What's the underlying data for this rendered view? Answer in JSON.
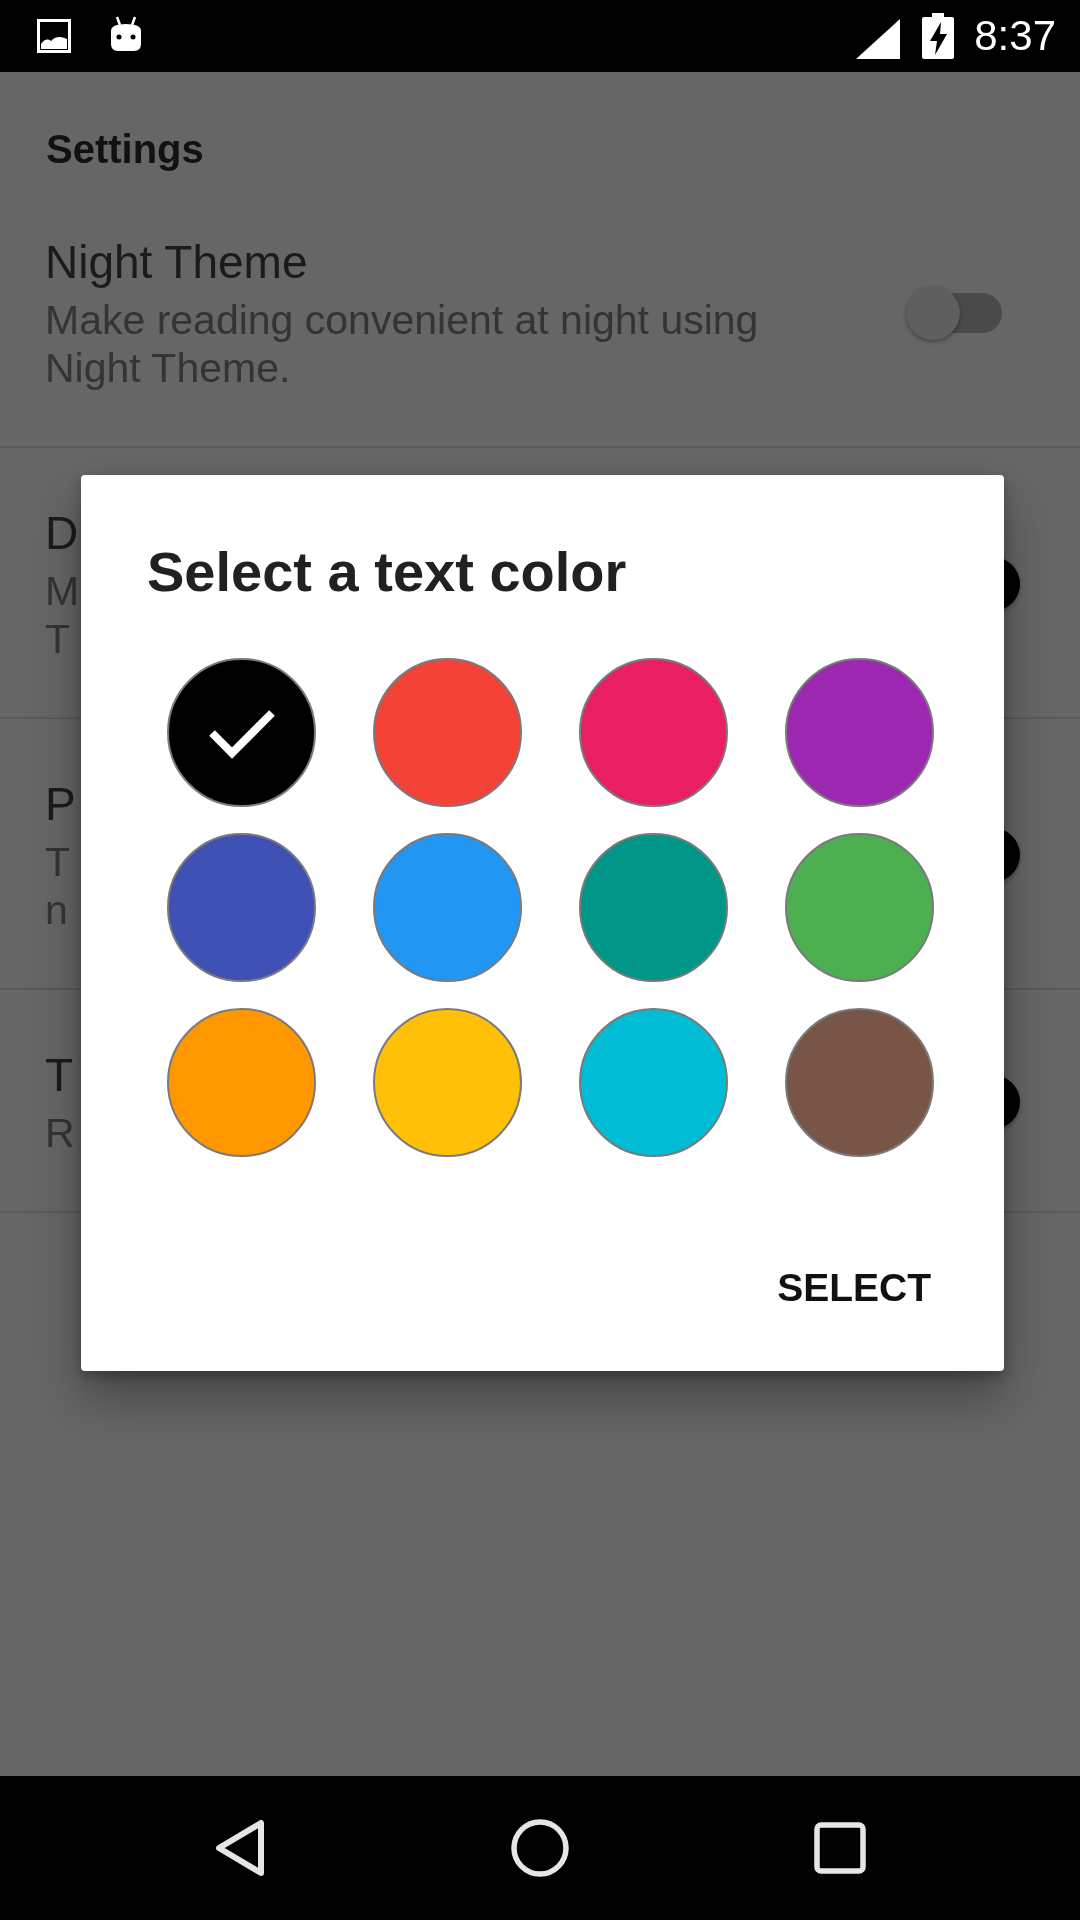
{
  "status_bar": {
    "time": "8:37"
  },
  "page": {
    "header": "Settings",
    "rows": [
      {
        "title": "Night Theme",
        "subtitle": "Make reading convenient at night using Night Theme.",
        "on": false
      },
      {
        "title": "D",
        "subtitle_lines": [
          "M",
          "T"
        ],
        "on": true
      },
      {
        "title": "P",
        "subtitle_lines": [
          "T",
          "n"
        ],
        "on": true
      },
      {
        "title": "T",
        "subtitle_lines": [
          "R"
        ],
        "on": true
      }
    ]
  },
  "dialog": {
    "title": "Select a text color",
    "swatches": [
      {
        "color": "#000000",
        "selected": true
      },
      {
        "color": "#f44336",
        "selected": false
      },
      {
        "color": "#e91e63",
        "selected": false
      },
      {
        "color": "#9c27b0",
        "selected": false
      },
      {
        "color": "#3f51b5",
        "selected": false
      },
      {
        "color": "#2196f3",
        "selected": false
      },
      {
        "color": "#009688",
        "selected": false
      },
      {
        "color": "#4caf50",
        "selected": false
      },
      {
        "color": "#ff9800",
        "selected": false
      },
      {
        "color": "#ffc107",
        "selected": false
      },
      {
        "color": "#00bcd4",
        "selected": false
      },
      {
        "color": "#795548",
        "selected": false
      }
    ],
    "button": "SELECT"
  }
}
